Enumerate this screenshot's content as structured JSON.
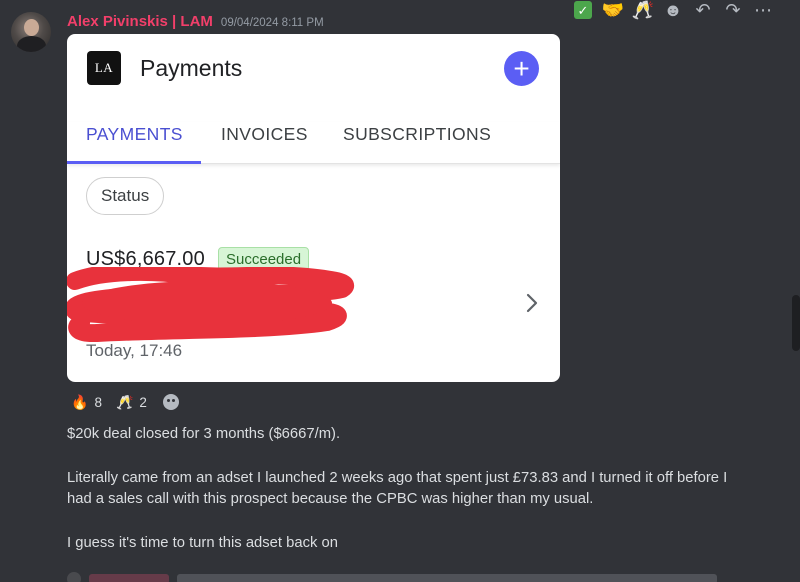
{
  "message": {
    "author": "Alex Pivinskis | LAM",
    "timestamp": "09/04/2024 8:11 PM",
    "lines": [
      "$20k deal closed for 3 months ($6667/m).",
      "Literally came from an adset I launched 2 weeks ago that spent just £73.83 and I turned it off before I had a sales call with this prospect because the CPBC was higher than my usual.",
      "I guess it's time to turn this adset back on"
    ]
  },
  "toolbar": {
    "icons": [
      "check-emoji",
      "handshake-emoji",
      "cheers-emoji",
      "add-reaction-icon",
      "reply-icon",
      "forward-icon",
      "more-icon"
    ],
    "glyphs": {
      "check": "✓",
      "handshake": "🤝",
      "cheers": "🥂",
      "add_reaction": "☻",
      "reply": "↶",
      "forward": "↷",
      "more": "⋯"
    }
  },
  "card": {
    "logo_text": "LA",
    "title": "Payments",
    "fab": "+",
    "tabs": [
      {
        "label": "PAYMENTS",
        "active": true
      },
      {
        "label": "INVOICES",
        "active": false
      },
      {
        "label": "SUBSCRIPTIONS",
        "active": false
      }
    ],
    "filter_chip": "Status",
    "payment": {
      "amount": "US$6,667.00",
      "status": "Succeeded",
      "time": "Today, 17:46"
    }
  },
  "reactions": [
    {
      "emoji": "🔥",
      "count": "8"
    },
    {
      "emoji": "🥂",
      "count": "2"
    }
  ],
  "colors": {
    "background": "#313338",
    "username": "#f23f6a",
    "accent": "#5b5ef4",
    "success_bg": "#d7f5d6",
    "redaction": "#e8323c"
  }
}
